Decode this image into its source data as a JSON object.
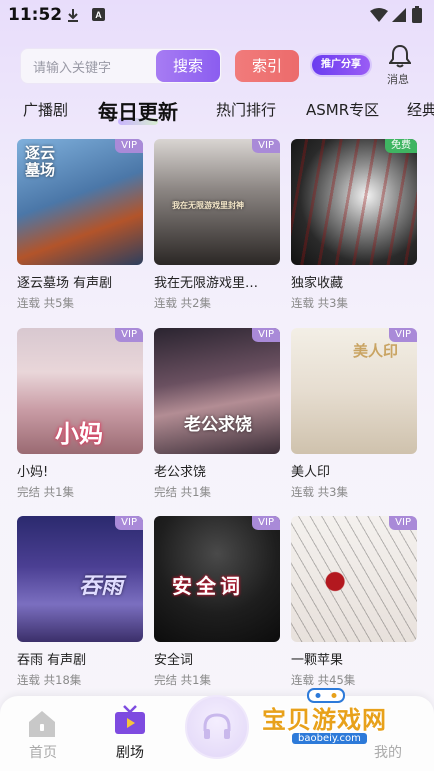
{
  "status_bar": {
    "time": "11:52"
  },
  "search": {
    "placeholder": "请输入关键字",
    "button": "搜索"
  },
  "index_button": "索引",
  "promo_button": "推广分享",
  "message": {
    "label": "消息"
  },
  "tabs": [
    "广播剧",
    "每日更新",
    "热门排行",
    "ASMR专区",
    "经典"
  ],
  "active_tab": "每日更新",
  "cards": [
    {
      "title": "逐云墓场 有声剧",
      "sub": "连载 共5集",
      "badge": "VIP",
      "cover_text": "逐云\n墓场"
    },
    {
      "title": "我在无限游戏里…",
      "sub": "连载 共2集",
      "badge": "VIP",
      "cover_text": "我在无限游戏里封神"
    },
    {
      "title": "独家收藏",
      "sub": "连载 共3集",
      "badge": "免费",
      "cover_text": ""
    },
    {
      "title": "小妈!",
      "sub": "完结 共1集",
      "badge": "VIP",
      "cover_text": "小妈"
    },
    {
      "title": "老公求饶",
      "sub": "完结 共1集",
      "badge": "VIP",
      "cover_text": "老公求饶"
    },
    {
      "title": "美人印",
      "sub": "连载 共3集",
      "badge": "VIP",
      "cover_text": "美人印"
    },
    {
      "title": "吞雨 有声剧",
      "sub": "连载 共18集",
      "badge": "VIP",
      "cover_text": "吞雨"
    },
    {
      "title": "安全词",
      "sub": "完结 共1集",
      "badge": "VIP",
      "cover_text": "安全词"
    },
    {
      "title": "一颗苹果",
      "sub": "连载 共45集",
      "badge": "VIP",
      "cover_text": ""
    }
  ],
  "bottom_nav": [
    {
      "label": "首页",
      "icon": "home-icon"
    },
    {
      "label": "剧场",
      "icon": "theater-icon"
    },
    {
      "label": "",
      "icon": "headphones-icon"
    },
    {
      "label": "我的",
      "icon": "profile-icon"
    }
  ],
  "watermark": {
    "text": "宝贝游戏网",
    "url": "baobeiy.com"
  },
  "colors": {
    "accent": "#8b5df0",
    "index": "#ec6b6b",
    "vip_badge": "#a98ad8",
    "free_badge": "#3fb562"
  }
}
